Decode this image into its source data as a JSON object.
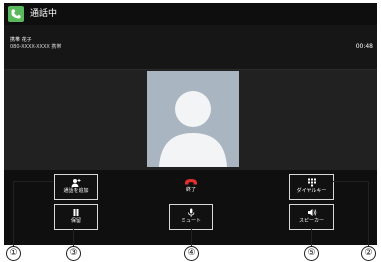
{
  "app": {
    "title": "通話中"
  },
  "caller": {
    "name": "携帯 花子",
    "number": "080-XXXX-XXXX 携帯",
    "duration": "00:48"
  },
  "buttons": {
    "add_call": "通話を追加",
    "end_call": "終了",
    "dialpad": "ダイヤルキー",
    "hold": "保留",
    "mute": "ミュート",
    "speaker": "スピーカー"
  },
  "callouts": [
    "①",
    "③",
    "④",
    "⑤",
    "②"
  ],
  "colors": {
    "app_icon": "#5cb85c",
    "end_call": "#e23030",
    "avatar_bg": "#a9b5c1"
  }
}
